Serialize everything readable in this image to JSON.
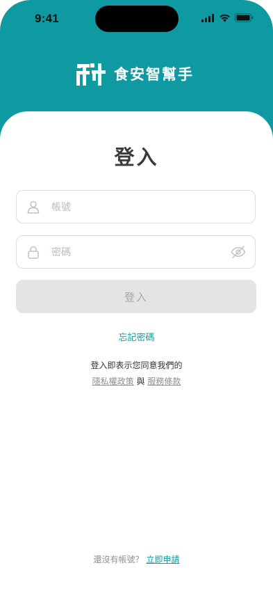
{
  "status_bar": {
    "time": "9:41"
  },
  "brand": {
    "name": "食安智幫手",
    "logo_icon": "fi-logo-icon"
  },
  "login": {
    "title": "登入",
    "account_placeholder": "帳號",
    "password_placeholder": "密碼",
    "submit_label": "登入",
    "forgot_password": "忘記密碼",
    "agreement_text": "登入即表示您同意我們的",
    "privacy_policy": "隱私權政策",
    "and_text": "與",
    "terms_of_service": "服務條款"
  },
  "signup": {
    "prompt": "還沒有帳號？",
    "link": "立即申請"
  },
  "colors": {
    "brand": "#0e9aa0",
    "button_disabled": "#e4e4e7",
    "text_dark": "#3a3a3a"
  }
}
